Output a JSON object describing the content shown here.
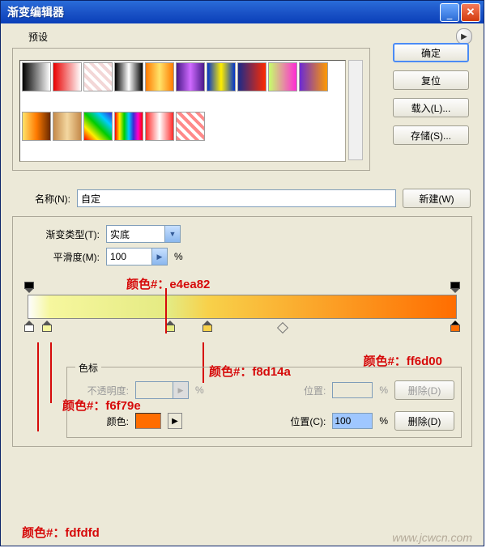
{
  "window": {
    "title": "渐变编辑器"
  },
  "buttons": {
    "ok": "确定",
    "reset": "复位",
    "load": "载入(L)...",
    "save": "存储(S)...",
    "new": "新建(W)",
    "delete": "删除(D)",
    "delete2": "删除(D)"
  },
  "labels": {
    "presets": "预设",
    "name": "名称(N):",
    "gradient_type": "渐变类型(T):",
    "smoothness": "平滑度(M):",
    "stops": "色标",
    "opacity": "不透明度:",
    "position": "位置:",
    "color": "颜色:",
    "position2": "位置(C):",
    "pct": "%"
  },
  "fields": {
    "name_value": "自定",
    "gradient_type_value": "实底",
    "smoothness_value": "100",
    "opacity_value": "",
    "position_value": "",
    "position2_value": "100"
  },
  "colors": {
    "current": "#ff6d00"
  },
  "annotations": {
    "c1": "颜色#：e4ea82",
    "c2": "颜色#：ff6d00",
    "c3": "颜色#：f8d14a",
    "c4": "颜色#：f6f79e",
    "c5": "颜色#：fdfdfd"
  },
  "watermark": "www.jcwcn.com",
  "chart_data": {
    "type": "gradient",
    "stops": [
      {
        "position": 0,
        "color": "#fdfdfd"
      },
      {
        "position": 5,
        "color": "#f6f79e"
      },
      {
        "position": 33,
        "color": "#e4ea82"
      },
      {
        "position": 42,
        "color": "#f8d14a"
      },
      {
        "position": 100,
        "color": "#ff6d00"
      }
    ],
    "opacity_stops": [
      {
        "position": 0,
        "opacity": 100
      },
      {
        "position": 100,
        "opacity": 100
      }
    ],
    "midpoint": 60
  },
  "preset_gradients": [
    "linear-gradient(to right,#000,#fff)",
    "linear-gradient(to right,#e80000,#fff)",
    "repeating-linear-gradient(45deg,#fff,#fff 4px,#f3d7d7 4px,#f3d7d7 8px)",
    "linear-gradient(to right,#000,#fff,#000)",
    "linear-gradient(to right,#ff7a00,#ffe36a,#ff7a00)",
    "linear-gradient(to right,#4a1a8a,#d06aff,#4a1a8a)",
    "linear-gradient(to right,#0033cc,#ffee00,#0033cc)",
    "linear-gradient(to right,#1a2a8a,#ff2a00)",
    "linear-gradient(to right,#c6ff6a,#ff2ad4)",
    "linear-gradient(to right,#6a2ad4,#ff9a00)",
    "linear-gradient(to right,#ffe36a,#ff7a00,#6a2a00)",
    "linear-gradient(to right,#c58a4a,#f3d7a0,#c58a4a)",
    "linear-gradient(45deg,#ff0000,#ffee00,#00cc00,#00ccff,#3a2ad4)",
    "linear-gradient(to right,#ff0000,#ffee00,#00cc00,#00ccff,#3a2ad4,#ff00cc,#ff0000)",
    "linear-gradient(to right,#ff2a2a,#fff,#ff2a2a)",
    "repeating-linear-gradient(45deg,#ff8a8a,#ff8a8a 4px,#fff 4px,#fff 8px)"
  ]
}
